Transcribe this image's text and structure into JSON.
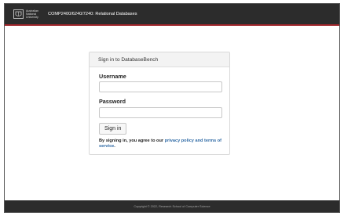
{
  "header": {
    "logo_lines": [
      "Australian",
      "National",
      "University"
    ],
    "title": "COMP2400/6240/7240: Relational Databases"
  },
  "login": {
    "heading": "Sign in to DatabaseBench",
    "username_label": "Username",
    "username_value": "",
    "password_label": "Password",
    "password_value": "",
    "submit_label": "Sign in",
    "terms_prefix": "By signing in, you agree to our ",
    "terms_link": "privacy policy and terms of service",
    "terms_suffix": "."
  },
  "footer": {
    "copyright": "Copyright © 2022, Research School of Computer Science"
  },
  "colors": {
    "navbar": "#2c2c2c",
    "accent": "#a0262b",
    "link": "#2f6aa5"
  }
}
